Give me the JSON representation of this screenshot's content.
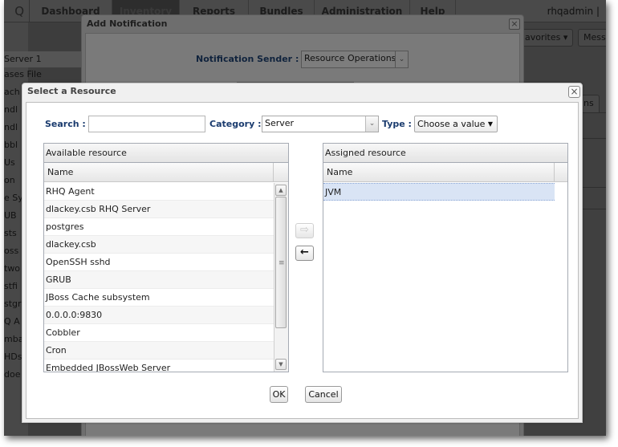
{
  "background_app": {
    "logo": "Q",
    "nav": [
      {
        "label": "Dashboard"
      },
      {
        "label": "Inventory",
        "active": true
      },
      {
        "label": "Reports"
      },
      {
        "label": "Bundles"
      },
      {
        "label": "Administration"
      },
      {
        "label": "Help"
      }
    ],
    "user": "rhqadmin |",
    "sidebar_items": [
      "Server 1",
      "ases File",
      "ach",
      "ndl",
      "ndl",
      "bbl",
      "Us",
      "on",
      "e Sy",
      "UB",
      "sts",
      "oss",
      "two",
      "stfi",
      "stgr",
      "Q A",
      "mba",
      "HDs",
      "doe"
    ],
    "toolbar": {
      "favorites_label": "avorites ▾",
      "messages_label": "Messa"
    },
    "tab_fragment": "ns"
  },
  "add_notification": {
    "title": "Add Notification",
    "sender_label": "Notification Sender :",
    "sender_value": "Resource Operations"
  },
  "select_resource": {
    "title": "Select a Resource",
    "search_label": "Search :",
    "search_value": "",
    "category_label": "Category :",
    "category_value": "Server",
    "type_label": "Type :",
    "type_value": "Choose a value",
    "available": {
      "caption": "Available resource",
      "column": "Name",
      "rows": [
        "RHQ Agent",
        "dlackey.csb RHQ Server",
        "postgres",
        "dlackey.csb",
        "OpenSSH sshd",
        "GRUB",
        "JBoss Cache subsystem",
        "0.0.0.0:9830",
        "Cobbler",
        "Cron",
        "Embedded JBossWeb Server"
      ]
    },
    "assigned": {
      "caption": "Assigned resource",
      "column": "Name",
      "rows": [
        "JVM"
      ]
    },
    "add_icon": "⇨",
    "remove_icon": "🡐",
    "ok_label": "OK",
    "cancel_label": "Cancel",
    "close_icon": "×"
  }
}
